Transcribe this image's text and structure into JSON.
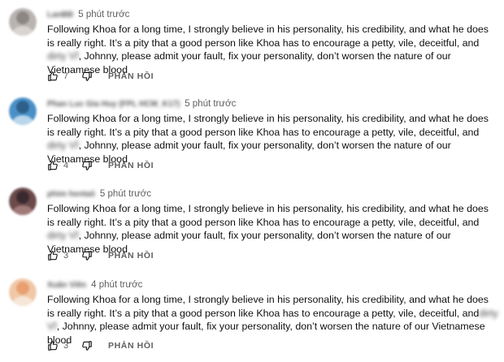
{
  "comments": [
    {
      "author": "LanBÐ",
      "time": "5 phút trước",
      "text_before": "Following Khoa for a long time, I strongly believe in his personality, his credibility, and what he does is really right. It’s a pity that a good person like Khoa has to encourage a petty, vile, deceitful, and ",
      "text_blurred": "dirty Vĩ",
      "text_after": ", Johnny, please admit your fault, fix your personality, don’t worsen the nature of our Vietnamese blood",
      "likes": "7",
      "reply_label": "PHẢN HỒI",
      "avatar_colors": [
        "#b9b4b1",
        "#8d8784",
        "#d8d4d0"
      ]
    },
    {
      "author": "Phan Luc Gia Huy (FPL HCM_K17)",
      "time": "5 phút trước",
      "text_before": "Following Khoa for a long time, I strongly believe in his personality, his credibility, and what he does is really right. It’s a pity that a good person like Khoa has to encourage a petty, vile, deceitful, and ",
      "text_blurred": "dirty Vĩ",
      "text_after": ", Johnny, please admit your fault, fix your personality, don’t worsen the nature of our Vietnamese blood",
      "likes": "4",
      "reply_label": "PHẢN HỒI",
      "avatar_colors": [
        "#4a90c8",
        "#2e5f8a",
        "#b9d6ea"
      ]
    },
    {
      "author": "phim hentaii",
      "time": "5 phút trước",
      "text_before": "Following Khoa for a long time, I strongly believe in his personality, his credibility, and what he does is really right. It’s a pity that a good person like Khoa has to encourage a petty, vile, deceitful, and ",
      "text_blurred": "dirty Vĩ",
      "text_after": ", Johnny, please admit your fault, fix your personality, don’t worsen the nature of our Vietnamese blood",
      "likes": "3",
      "reply_label": "PHẢN HỒI",
      "avatar_colors": [
        "#6b4a4a",
        "#3a2a30",
        "#a07a78"
      ]
    },
    {
      "author": "Xuân Viên",
      "time": "4 phút trước",
      "text_before": "Following Khoa for a long time, I strongly believe in his personality, his credibility, and what he does is really right. It’s a pity that a good person like Khoa has to encourage a petty, vile, deceitful, and",
      "text_blurred": "dirty Vĩ",
      "text_after": ", Johnny, please admit your fault, fix your personality, don’t worsen the nature of our Vietnamese blood",
      "likes": "3",
      "reply_label": "PHẢN HỒI",
      "avatar_colors": [
        "#f0c8a8",
        "#e8a070",
        "#f6e6d8"
      ]
    }
  ]
}
